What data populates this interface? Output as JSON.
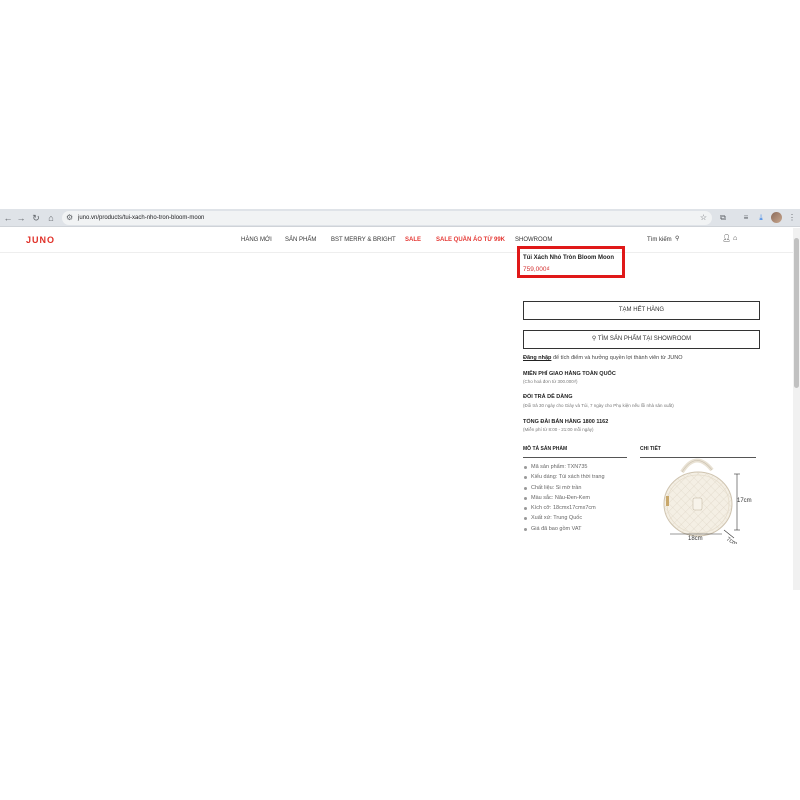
{
  "browser": {
    "url": "juno.vn/products/tui-xach-nho-tron-bloom-moon",
    "icons": [
      "back-icon",
      "forward-icon",
      "reload-icon",
      "home-icon",
      "site-info-icon",
      "bookmark-star-icon",
      "extensions-icon",
      "cast-icon",
      "download-icon",
      "sidebar-icon",
      "profile-avatar"
    ]
  },
  "header": {
    "logo": "JUNO",
    "menu": [
      {
        "label": "HÀNG MỚI",
        "sale": false
      },
      {
        "label": "SẢN PHẨM",
        "sale": false
      },
      {
        "label": "BST MERRY & BRIGHT",
        "sale": false
      },
      {
        "label": "SALE",
        "sale": true
      },
      {
        "label": "SALE QUẦN ÁO TỪ 99K",
        "sale": true
      },
      {
        "label": "SHOWROOM",
        "sale": false
      }
    ],
    "search_label": "Tìm kiếm"
  },
  "product": {
    "name": "Túi Xách Nhỏ Tròn Bloom Moon",
    "price": "759,000₫",
    "out_of_stock_label": "TẠM HẾT HÀNG",
    "find_showroom_label": "TÌM SẢN PHẨM TẠI SHOWROOM",
    "login_link": "Đăng nhập",
    "login_text": " để tích điểm và hưởng quyền lợi thành viên từ JUNO",
    "info": [
      {
        "title": "MIỄN PHÍ GIAO HÀNG TOÀN QUỐC",
        "sub": "(Cho hoá đơn từ 300.000₫)"
      },
      {
        "title": "ĐỔI TRẢ DỄ DÀNG",
        "sub": "(Đổi trả 30 ngày cho Giày và Túi, 7 ngày cho Phụ kiện nếu lỗi nhà sản xuất)"
      },
      {
        "title": "TỔNG ĐÀI BÁN HÀNG 1800 1162",
        "sub": "(Miễn phí từ 8:00 - 21:00 mỗi ngày)"
      }
    ],
    "tabs": {
      "description": "MÔ TẢ SẢN PHẨM",
      "detail": "CHI TIẾT"
    },
    "specs": [
      "Mã sản phẩm: TXN735",
      "Kiểu dáng: Túi xách thời trang",
      "Chất liệu: Si mờ trần",
      "Màu sắc: Nâu-Đen-Kem",
      "Kích cỡ: 18cmx17cmx7cm",
      "Xuất xứ: Trung Quốc",
      "Giá đã bao gồm VAT"
    ],
    "dimensions": {
      "height": "17cm",
      "width": "18cm",
      "depth": "7cm"
    }
  },
  "colors": {
    "brand": "#e03028",
    "sale": "#e53935",
    "highlight": "#e01818",
    "price": "#d32f2f"
  }
}
